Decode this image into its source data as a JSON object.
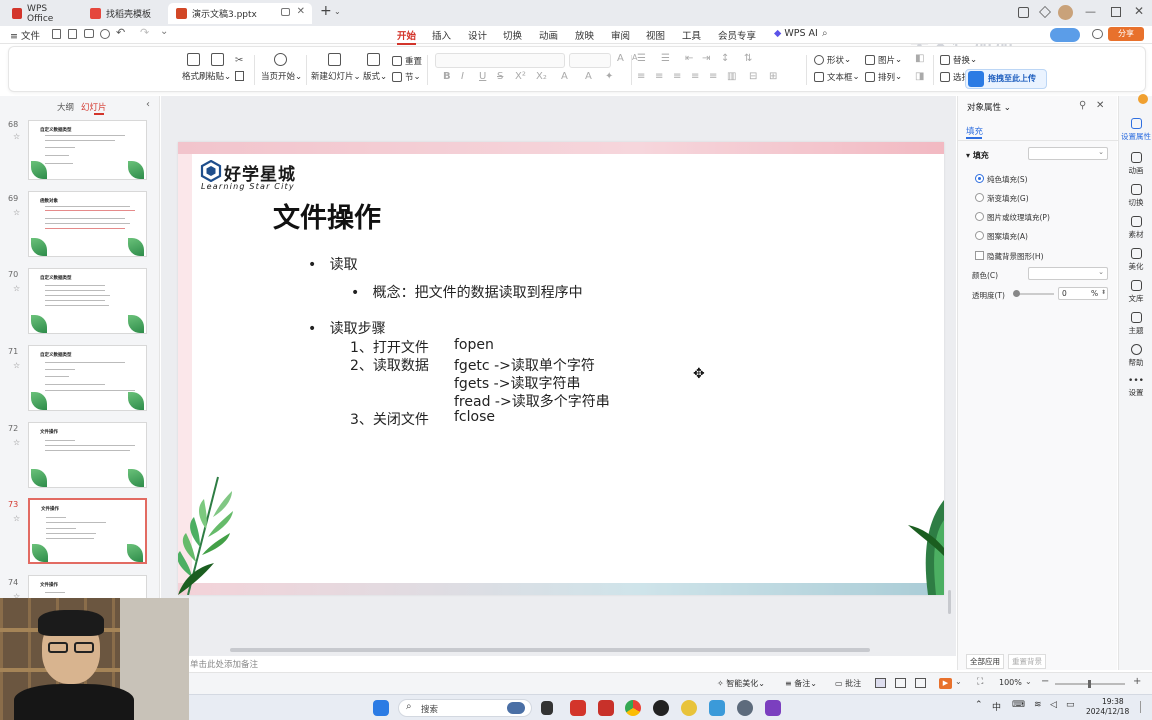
{
  "titlebar": {
    "tabs": [
      {
        "label": "WPS Office",
        "color": "#d3352b"
      },
      {
        "label": "找稻壳模板",
        "color": "#e5473d"
      },
      {
        "label": "演示文稿3.pptx",
        "color": "#d24726"
      }
    ],
    "new_tab": "+",
    "watermark": "天禾仁加加"
  },
  "menubar": {
    "file": "文件",
    "items": [
      "开始",
      "插入",
      "设计",
      "切换",
      "动画",
      "放映",
      "审阅",
      "视图",
      "工具",
      "会员专享"
    ],
    "wps_ai": "WPS AI",
    "share": "分享"
  },
  "ribbon": {
    "format_painter": "格式刷",
    "paste": "粘贴",
    "from_start": "当页开始",
    "new_slide": "新建幻灯片",
    "layout": "版式",
    "section": "节",
    "reset": "重置",
    "shape": "形状",
    "textbox": "文本框",
    "picture": "图片",
    "arrange": "排列",
    "replace": "替换",
    "select": "选择",
    "upload_label": "拖拽至此上传"
  },
  "leftpane": {
    "tab_outline": "大纲",
    "tab_slides": "幻灯片",
    "slides": [
      {
        "num": "68",
        "title": "自定义数据类型"
      },
      {
        "num": "69",
        "title": "函数对象"
      },
      {
        "num": "70",
        "title": "自定义数据类型"
      },
      {
        "num": "71",
        "title": "自定义数据类型"
      },
      {
        "num": "72",
        "title": "文件操作"
      },
      {
        "num": "73",
        "title": "文件操作"
      },
      {
        "num": "74",
        "title": "文件操作"
      }
    ]
  },
  "slide": {
    "logo_cn": "好学星城",
    "logo_en": "Learning Star City",
    "title": "文件操作",
    "bullet1": "读取",
    "sub1": "概念：把文件的数据读取到程序中",
    "bullet2": "读取步骤",
    "steps": [
      {
        "label": "1、打开文件",
        "value": "fopen"
      },
      {
        "label": "2、读取数据",
        "value": "fgetc ->读取单个字符"
      },
      {
        "label": "",
        "value": "fgets ->读取字符串"
      },
      {
        "label": "",
        "value": "fread ->读取多个字符串"
      },
      {
        "label": "3、关闭文件",
        "value": "fclose"
      }
    ]
  },
  "rightpane": {
    "title": "对象属性",
    "tab_fill": "填充",
    "section_fill": "填充",
    "options": [
      "纯色填充(S)",
      "渐变填充(G)",
      "图片或纹理填充(P)",
      "图案填充(A)"
    ],
    "hide_bg": "隐藏背景图形(H)",
    "color_label": "颜色(C)",
    "transparency_label": "透明度(T)",
    "transparency_value": "0",
    "percent": "%",
    "apply_all": "全部应用",
    "reset_bg": "重置背景"
  },
  "iconrail": [
    "设置属性",
    "动画",
    "切换",
    "素材",
    "美化",
    "文库",
    "主题",
    "帮助",
    "设置"
  ],
  "statusbar": {
    "notes_hint": "单击此处添加备注",
    "smart_beautify": "智能美化",
    "notes": "备注",
    "comment": "批注",
    "zoom": "100%"
  },
  "taskbar": {
    "search": "搜索",
    "time": "19:38",
    "date": "2024/12/18"
  }
}
